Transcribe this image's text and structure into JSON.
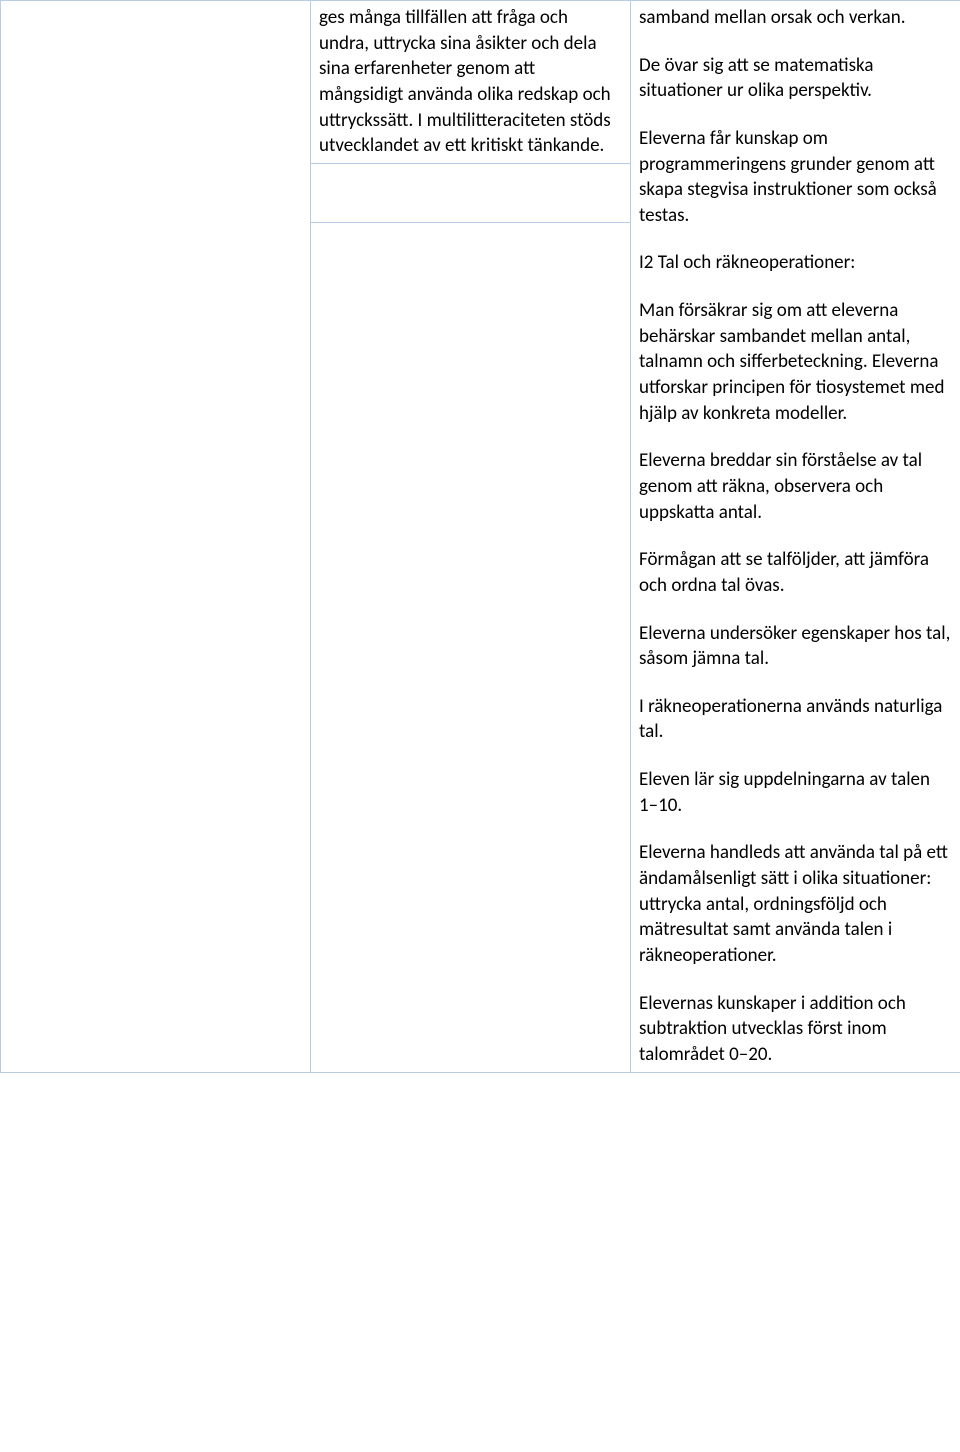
{
  "table": {
    "col1": {
      "content": ""
    },
    "col2": {
      "para1": "ges många tillfällen att fråga och undra, uttrycka sina åsikter och dela sina erfarenheter genom att mångsidigt använda olika redskap och uttryckssätt. I multilitteraciteten stöds utvecklandet av ett kritiskt tänkande."
    },
    "col3": {
      "p1": "samband mellan orsak och verkan.",
      "p2": "De övar sig att se matematiska situationer ur olika perspektiv.",
      "p3": "Eleverna får kunskap om programmeringens grunder genom att skapa stegvisa instruktioner som också testas.",
      "p4": "I2 Tal och räkneoperationer:",
      "p5": "Man försäkrar sig om att eleverna behärskar sambandet mellan antal, talnamn och sifferbeteckning. Eleverna utforskar principen för tiosystemet med hjälp av konkreta modeller.",
      "p6": "Eleverna breddar sin förståelse av tal genom att räkna, observera och uppskatta antal.",
      "p7": "Förmågan att se talföljder, att jämföra och ordna tal övas.",
      "p8": "Eleverna undersöker egenskaper hos tal, såsom jämna tal.",
      "p9": "I räkneoperationerna används naturliga tal.",
      "p10": "Eleven lär sig uppdelningarna av talen 1–10.",
      "p11": "Eleverna handleds att använda tal på ett ändamålsenligt sätt i olika situationer: uttrycka antal, ordningsföljd och mätresultat samt använda talen i räkneoperationer.",
      "p12": "Elevernas kunskaper i addition och subtraktion utvecklas först inom talområdet 0–20."
    }
  }
}
